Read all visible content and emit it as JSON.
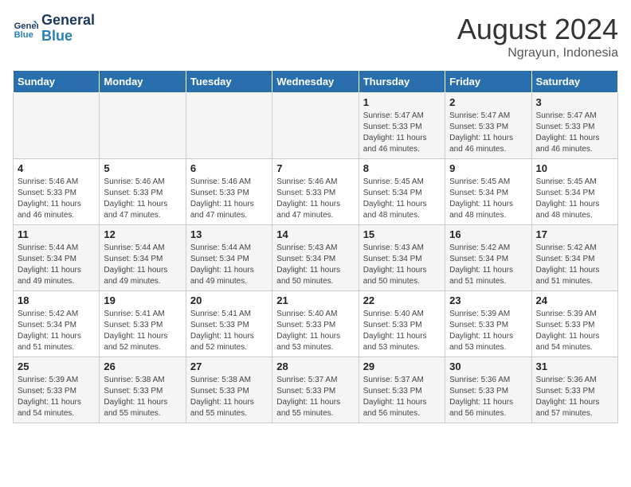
{
  "logo": {
    "line1": "General",
    "line2": "Blue"
  },
  "title": "August 2024",
  "location": "Ngrayun, Indonesia",
  "days_of_week": [
    "Sunday",
    "Monday",
    "Tuesday",
    "Wednesday",
    "Thursday",
    "Friday",
    "Saturday"
  ],
  "weeks": [
    [
      {
        "day": "",
        "content": ""
      },
      {
        "day": "",
        "content": ""
      },
      {
        "day": "",
        "content": ""
      },
      {
        "day": "",
        "content": ""
      },
      {
        "day": "1",
        "content": "Sunrise: 5:47 AM\nSunset: 5:33 PM\nDaylight: 11 hours\nand 46 minutes."
      },
      {
        "day": "2",
        "content": "Sunrise: 5:47 AM\nSunset: 5:33 PM\nDaylight: 11 hours\nand 46 minutes."
      },
      {
        "day": "3",
        "content": "Sunrise: 5:47 AM\nSunset: 5:33 PM\nDaylight: 11 hours\nand 46 minutes."
      }
    ],
    [
      {
        "day": "4",
        "content": "Sunrise: 5:46 AM\nSunset: 5:33 PM\nDaylight: 11 hours\nand 46 minutes."
      },
      {
        "day": "5",
        "content": "Sunrise: 5:46 AM\nSunset: 5:33 PM\nDaylight: 11 hours\nand 47 minutes."
      },
      {
        "day": "6",
        "content": "Sunrise: 5:46 AM\nSunset: 5:33 PM\nDaylight: 11 hours\nand 47 minutes."
      },
      {
        "day": "7",
        "content": "Sunrise: 5:46 AM\nSunset: 5:33 PM\nDaylight: 11 hours\nand 47 minutes."
      },
      {
        "day": "8",
        "content": "Sunrise: 5:45 AM\nSunset: 5:34 PM\nDaylight: 11 hours\nand 48 minutes."
      },
      {
        "day": "9",
        "content": "Sunrise: 5:45 AM\nSunset: 5:34 PM\nDaylight: 11 hours\nand 48 minutes."
      },
      {
        "day": "10",
        "content": "Sunrise: 5:45 AM\nSunset: 5:34 PM\nDaylight: 11 hours\nand 48 minutes."
      }
    ],
    [
      {
        "day": "11",
        "content": "Sunrise: 5:44 AM\nSunset: 5:34 PM\nDaylight: 11 hours\nand 49 minutes."
      },
      {
        "day": "12",
        "content": "Sunrise: 5:44 AM\nSunset: 5:34 PM\nDaylight: 11 hours\nand 49 minutes."
      },
      {
        "day": "13",
        "content": "Sunrise: 5:44 AM\nSunset: 5:34 PM\nDaylight: 11 hours\nand 49 minutes."
      },
      {
        "day": "14",
        "content": "Sunrise: 5:43 AM\nSunset: 5:34 PM\nDaylight: 11 hours\nand 50 minutes."
      },
      {
        "day": "15",
        "content": "Sunrise: 5:43 AM\nSunset: 5:34 PM\nDaylight: 11 hours\nand 50 minutes."
      },
      {
        "day": "16",
        "content": "Sunrise: 5:42 AM\nSunset: 5:34 PM\nDaylight: 11 hours\nand 51 minutes."
      },
      {
        "day": "17",
        "content": "Sunrise: 5:42 AM\nSunset: 5:34 PM\nDaylight: 11 hours\nand 51 minutes."
      }
    ],
    [
      {
        "day": "18",
        "content": "Sunrise: 5:42 AM\nSunset: 5:34 PM\nDaylight: 11 hours\nand 51 minutes."
      },
      {
        "day": "19",
        "content": "Sunrise: 5:41 AM\nSunset: 5:33 PM\nDaylight: 11 hours\nand 52 minutes."
      },
      {
        "day": "20",
        "content": "Sunrise: 5:41 AM\nSunset: 5:33 PM\nDaylight: 11 hours\nand 52 minutes."
      },
      {
        "day": "21",
        "content": "Sunrise: 5:40 AM\nSunset: 5:33 PM\nDaylight: 11 hours\nand 53 minutes."
      },
      {
        "day": "22",
        "content": "Sunrise: 5:40 AM\nSunset: 5:33 PM\nDaylight: 11 hours\nand 53 minutes."
      },
      {
        "day": "23",
        "content": "Sunrise: 5:39 AM\nSunset: 5:33 PM\nDaylight: 11 hours\nand 53 minutes."
      },
      {
        "day": "24",
        "content": "Sunrise: 5:39 AM\nSunset: 5:33 PM\nDaylight: 11 hours\nand 54 minutes."
      }
    ],
    [
      {
        "day": "25",
        "content": "Sunrise: 5:39 AM\nSunset: 5:33 PM\nDaylight: 11 hours\nand 54 minutes."
      },
      {
        "day": "26",
        "content": "Sunrise: 5:38 AM\nSunset: 5:33 PM\nDaylight: 11 hours\nand 55 minutes."
      },
      {
        "day": "27",
        "content": "Sunrise: 5:38 AM\nSunset: 5:33 PM\nDaylight: 11 hours\nand 55 minutes."
      },
      {
        "day": "28",
        "content": "Sunrise: 5:37 AM\nSunset: 5:33 PM\nDaylight: 11 hours\nand 55 minutes."
      },
      {
        "day": "29",
        "content": "Sunrise: 5:37 AM\nSunset: 5:33 PM\nDaylight: 11 hours\nand 56 minutes."
      },
      {
        "day": "30",
        "content": "Sunrise: 5:36 AM\nSunset: 5:33 PM\nDaylight: 11 hours\nand 56 minutes."
      },
      {
        "day": "31",
        "content": "Sunrise: 5:36 AM\nSunset: 5:33 PM\nDaylight: 11 hours\nand 57 minutes."
      }
    ]
  ]
}
